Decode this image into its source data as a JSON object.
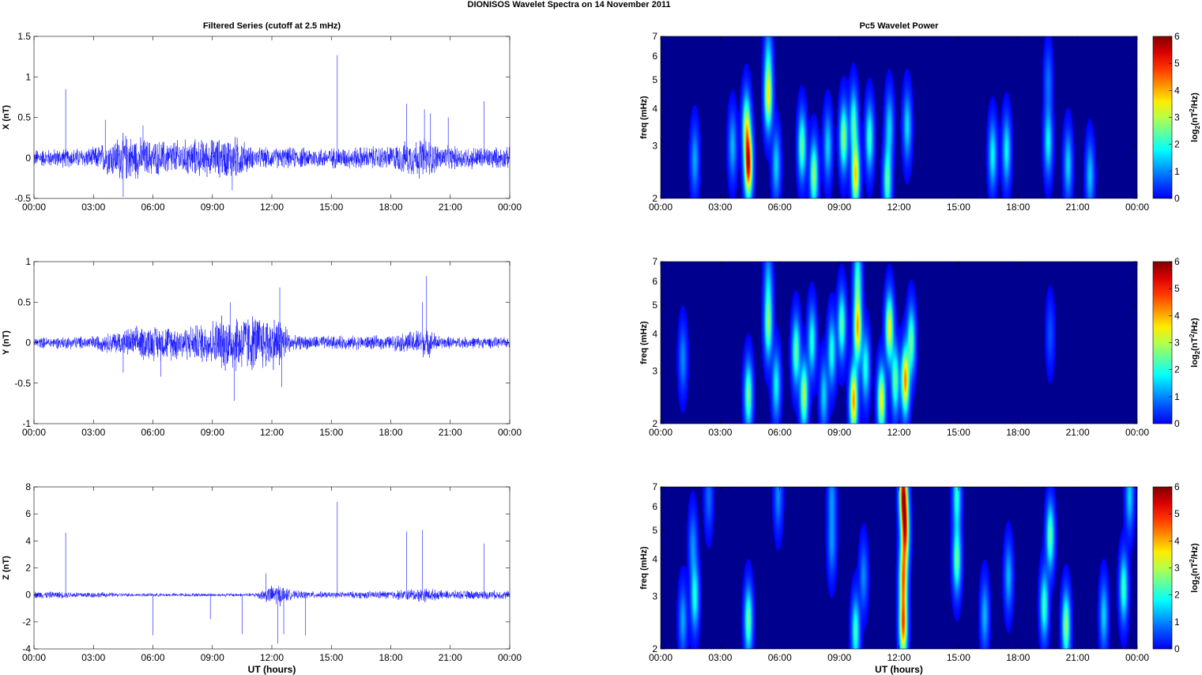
{
  "title": "DIONISOS Wavelet Spectra on 14 November  2011",
  "chart_data": [
    {
      "type": "line",
      "title": "Filtered Series (cutoff at 2.5 mHz)",
      "ylabel": "X (nT)",
      "xlabel": "",
      "xlim": [
        0,
        24
      ],
      "ylim": [
        -0.5,
        1.5
      ],
      "yticks": [
        "-0.5",
        "0",
        "0.5",
        "1",
        "1.5"
      ],
      "ytick_values": [
        -0.5,
        0,
        0.5,
        1,
        1.5
      ],
      "xticks": [
        "00:00",
        "03:00",
        "06:00",
        "09:00",
        "12:00",
        "15:00",
        "18:00",
        "21:00",
        "00:00"
      ],
      "noise_envelope": [
        [
          0,
          0.1
        ],
        [
          3,
          0.12
        ],
        [
          4.5,
          0.28
        ],
        [
          6,
          0.2
        ],
        [
          9,
          0.22
        ],
        [
          10.3,
          0.25
        ],
        [
          11,
          0.12
        ],
        [
          15,
          0.12
        ],
        [
          18,
          0.14
        ],
        [
          19.7,
          0.25
        ],
        [
          20.5,
          0.14
        ],
        [
          24,
          0.12
        ]
      ],
      "spikes": [
        [
          1.6,
          0.85
        ],
        [
          3.6,
          0.47
        ],
        [
          4.5,
          -0.48
        ],
        [
          5.5,
          0.4
        ],
        [
          15.3,
          1.27
        ],
        [
          18.8,
          0.67
        ],
        [
          19.7,
          0.6
        ],
        [
          20.0,
          0.55
        ],
        [
          20.9,
          0.5
        ],
        [
          22.7,
          0.7
        ],
        [
          10.0,
          -0.4
        ]
      ]
    },
    {
      "type": "line",
      "ylabel": "Y (nT)",
      "xlabel": "",
      "xlim": [
        0,
        24
      ],
      "ylim": [
        -1,
        1
      ],
      "yticks": [
        "-1",
        "-0.5",
        "0",
        "0.5",
        "1"
      ],
      "ytick_values": [
        -1,
        -0.5,
        0,
        0.5,
        1
      ],
      "xticks": [
        "00:00",
        "03:00",
        "06:00",
        "09:00",
        "12:00",
        "15:00",
        "18:00",
        "21:00",
        "00:00"
      ],
      "noise_envelope": [
        [
          0,
          0.06
        ],
        [
          3,
          0.08
        ],
        [
          5.5,
          0.2
        ],
        [
          8,
          0.2
        ],
        [
          10,
          0.35
        ],
        [
          12.5,
          0.3
        ],
        [
          13,
          0.08
        ],
        [
          18,
          0.08
        ],
        [
          19.8,
          0.18
        ],
        [
          20.5,
          0.07
        ],
        [
          24,
          0.06
        ]
      ],
      "spikes": [
        [
          10.1,
          -0.72
        ],
        [
          9.9,
          0.5
        ],
        [
          12.4,
          0.68
        ],
        [
          12.5,
          -0.55
        ],
        [
          19.8,
          0.82
        ],
        [
          19.6,
          0.5
        ],
        [
          6.4,
          -0.42
        ],
        [
          4.5,
          -0.37
        ]
      ]
    },
    {
      "type": "line",
      "ylabel": "Z (nT)",
      "xlabel": "UT (hours)",
      "xlim": [
        0,
        24
      ],
      "ylim": [
        -4,
        8
      ],
      "yticks": [
        "-4",
        "-2",
        "0",
        "2",
        "4",
        "6",
        "8"
      ],
      "ytick_values": [
        -4,
        -2,
        0,
        2,
        4,
        6,
        8
      ],
      "xticks": [
        "00:00",
        "03:00",
        "06:00",
        "09:00",
        "12:00",
        "15:00",
        "18:00",
        "21:00",
        "00:00"
      ],
      "noise_envelope": [
        [
          0,
          0.25
        ],
        [
          3,
          0.2
        ],
        [
          5,
          0.12
        ],
        [
          11,
          0.12
        ],
        [
          12.3,
          0.8
        ],
        [
          13,
          0.3
        ],
        [
          15,
          0.2
        ],
        [
          18,
          0.3
        ],
        [
          19.7,
          0.5
        ],
        [
          20.5,
          0.3
        ],
        [
          24,
          0.3
        ]
      ],
      "spikes": [
        [
          1.6,
          4.6
        ],
        [
          6.0,
          -3.0
        ],
        [
          8.9,
          -1.8
        ],
        [
          10.5,
          -2.9
        ],
        [
          11.7,
          1.6
        ],
        [
          12.3,
          -3.6
        ],
        [
          12.6,
          -2.9
        ],
        [
          13.7,
          -3.0
        ],
        [
          15.3,
          6.9
        ],
        [
          18.8,
          4.7
        ],
        [
          19.6,
          4.8
        ],
        [
          22.7,
          3.8
        ]
      ]
    },
    {
      "type": "heatmap",
      "title": "Pc5 Wavelet Power",
      "ylabel": "freq (mHz)",
      "xlabel": "",
      "xlim": [
        0,
        24
      ],
      "ylim": [
        2,
        7
      ],
      "yscale": "log",
      "yticks": [
        "2",
        "3",
        "4",
        "5",
        "6",
        "7"
      ],
      "ytick_values": [
        2,
        3,
        4,
        5,
        6,
        7
      ],
      "xticks": [
        "00:00",
        "03:00",
        "06:00",
        "09:00",
        "12:00",
        "15:00",
        "18:00",
        "21:00",
        "00:00"
      ],
      "colorbar": {
        "label": "log2(nT2/Hz)",
        "range": [
          0,
          6
        ],
        "ticks": [
          "0",
          "1",
          "2",
          "3",
          "4",
          "5",
          "6"
        ]
      },
      "blobs_hour_mHz_power": [
        [
          1.7,
          2.7,
          1.2
        ],
        [
          3.6,
          3.0,
          1.3
        ],
        [
          4.4,
          2.6,
          5.3
        ],
        [
          4.3,
          3.5,
          3
        ],
        [
          5.4,
          4.4,
          3.4
        ],
        [
          5.4,
          6,
          1.2
        ],
        [
          5.8,
          2.6,
          1.5
        ],
        [
          7.1,
          3,
          2.5
        ],
        [
          7.7,
          2.4,
          2.8
        ],
        [
          8.4,
          3,
          1.5
        ],
        [
          9.2,
          3.2,
          2.8
        ],
        [
          9.8,
          2.4,
          3.8
        ],
        [
          9.7,
          3.6,
          2.2
        ],
        [
          10.5,
          3.2,
          2.2
        ],
        [
          11.4,
          2.3,
          2.4
        ],
        [
          11.5,
          3.5,
          1.5
        ],
        [
          12.4,
          3.5,
          1.6
        ],
        [
          16.7,
          2.8,
          1.8
        ],
        [
          17.4,
          2.9,
          1.8
        ],
        [
          19.5,
          3.1,
          1.8
        ],
        [
          19.5,
          5,
          0.8
        ],
        [
          20.5,
          2.6,
          1.5
        ],
        [
          21.6,
          2.4,
          1.4
        ]
      ]
    },
    {
      "type": "heatmap",
      "ylabel": "freq (mHz)",
      "xlabel": "",
      "xlim": [
        0,
        24
      ],
      "ylim": [
        2,
        7
      ],
      "yscale": "log",
      "yticks": [
        "2",
        "3",
        "4",
        "5",
        "6",
        "7"
      ],
      "ytick_values": [
        2,
        3,
        4,
        5,
        6,
        7
      ],
      "xticks": [
        "00:00",
        "03:00",
        "06:00",
        "09:00",
        "12:00",
        "15:00",
        "18:00",
        "21:00",
        "00:00"
      ],
      "colorbar": {
        "label": "log2(nT2/Hz)",
        "range": [
          0,
          6
        ],
        "ticks": [
          "0",
          "1",
          "2",
          "3",
          "4",
          "5",
          "6"
        ]
      },
      "blobs_hour_mHz_power": [
        [
          1.1,
          3.3,
          1
        ],
        [
          4.4,
          2.5,
          2.6
        ],
        [
          5.4,
          4.3,
          2.6
        ],
        [
          5.4,
          6,
          1.2
        ],
        [
          5.8,
          2.7,
          1.8
        ],
        [
          6.8,
          3.5,
          2.5
        ],
        [
          7.2,
          2.5,
          3
        ],
        [
          7.6,
          3.8,
          2
        ],
        [
          8.2,
          2.5,
          1.5
        ],
        [
          8.6,
          3.5,
          2
        ],
        [
          9.1,
          4.3,
          2.4
        ],
        [
          9.7,
          2.4,
          4.2
        ],
        [
          9.9,
          4.2,
          4
        ],
        [
          9.9,
          6.2,
          2
        ],
        [
          10.3,
          3.1,
          2
        ],
        [
          11.1,
          2.4,
          3.5
        ],
        [
          11.5,
          4.2,
          3.5
        ],
        [
          11.8,
          2.8,
          2.5
        ],
        [
          12.3,
          2.8,
          4.3
        ],
        [
          12.6,
          3.8,
          2.5
        ],
        [
          19.6,
          4,
          0.6
        ]
      ]
    },
    {
      "type": "heatmap",
      "ylabel": "freq (mHz)",
      "xlabel": "UT (hours)",
      "xlim": [
        0,
        24
      ],
      "ylim": [
        2,
        7
      ],
      "yscale": "log",
      "yticks": [
        "2",
        "3",
        "4",
        "5",
        "6",
        "7"
      ],
      "ytick_values": [
        2,
        3,
        4,
        5,
        6,
        7
      ],
      "xticks": [
        "00:00",
        "03:00",
        "06:00",
        "09:00",
        "12:00",
        "15:00",
        "18:00",
        "21:00",
        "00:00"
      ],
      "colorbar": {
        "label": "log2(nT2/Hz)",
        "range": [
          0,
          6
        ],
        "ticks": [
          "0",
          "1",
          "2",
          "3",
          "4",
          "5",
          "6"
        ]
      },
      "blobs_hour_mHz_power": [
        [
          1.1,
          2.5,
          1.2
        ],
        [
          1.7,
          3,
          2
        ],
        [
          1.6,
          4.5,
          1
        ],
        [
          2.4,
          6.5,
          0.8
        ],
        [
          4.4,
          2.5,
          2.5
        ],
        [
          5.9,
          6.5,
          1
        ],
        [
          8.6,
          4.5,
          1
        ],
        [
          8.6,
          6.5,
          1
        ],
        [
          9.8,
          2.3,
          2.2
        ],
        [
          10.2,
          3.5,
          1
        ],
        [
          12.2,
          2.4,
          4.5
        ],
        [
          12.2,
          3.5,
          4
        ],
        [
          12.3,
          5,
          4.5
        ],
        [
          12.2,
          6.7,
          5.2
        ],
        [
          14.9,
          4,
          2.5
        ],
        [
          14.9,
          6.5,
          2
        ],
        [
          16.3,
          2.6,
          1.3
        ],
        [
          17.5,
          3.5,
          1.3
        ],
        [
          19.3,
          2.8,
          2.2
        ],
        [
          19.6,
          4.8,
          2.5
        ],
        [
          20.4,
          2.4,
          2.8
        ],
        [
          22.3,
          2.6,
          1.5
        ],
        [
          23.3,
          3.2,
          2.2
        ],
        [
          23.6,
          6.5,
          1.5
        ]
      ]
    }
  ]
}
